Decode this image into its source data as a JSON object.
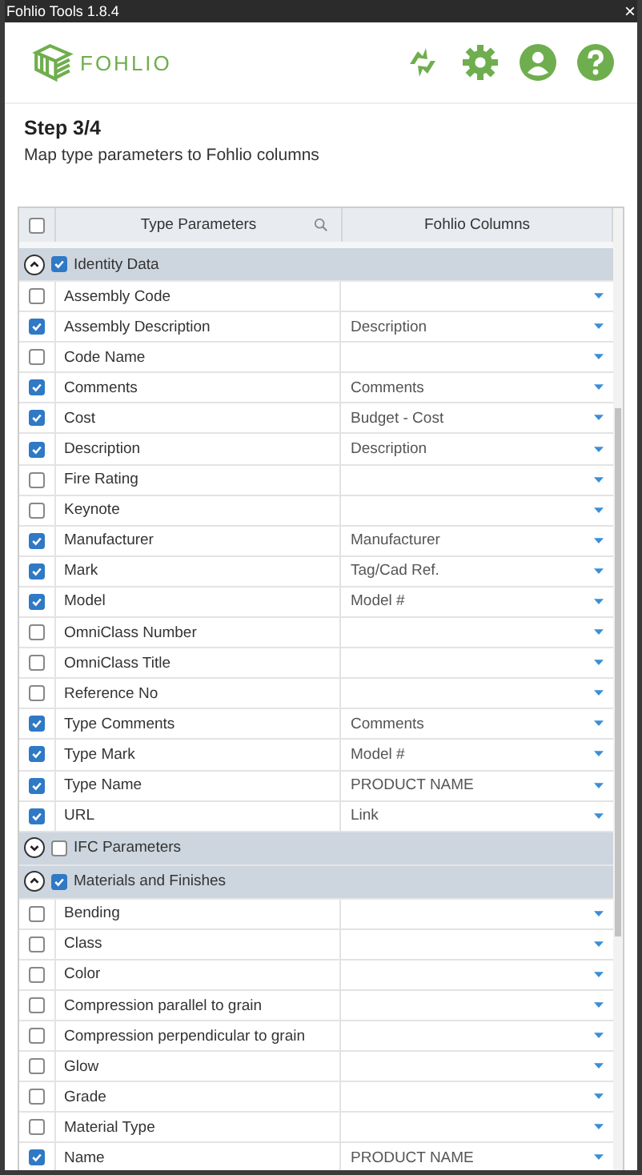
{
  "window": {
    "title": "Fohlio Tools 1.8.4",
    "close": "×"
  },
  "header": {
    "logo_text": "FOHLIO"
  },
  "step": {
    "title": "Step 3/4",
    "subtitle": "Map type parameters to Fohlio columns"
  },
  "table": {
    "select_all_checked": false,
    "columns": [
      "Type Parameters",
      "Fohlio Columns"
    ],
    "groups": [
      {
        "name": "Identity Data",
        "expanded": true,
        "checked": true,
        "rows": [
          {
            "parameter": "Assembly Code",
            "checked": false
          },
          {
            "parameter": "Assembly Description",
            "checked": true,
            "column": "Description"
          },
          {
            "parameter": "Code Name",
            "checked": false
          },
          {
            "parameter": "Comments",
            "checked": true,
            "column": "Comments"
          },
          {
            "parameter": "Cost",
            "checked": true,
            "column": "Budget - Cost"
          },
          {
            "parameter": "Description",
            "checked": true,
            "column": "Description"
          },
          {
            "parameter": "Fire Rating",
            "checked": false
          },
          {
            "parameter": "Keynote",
            "checked": false
          },
          {
            "parameter": "Manufacturer",
            "checked": true,
            "column": "Manufacturer"
          },
          {
            "parameter": "Mark",
            "checked": true,
            "column": "Tag/Cad Ref."
          },
          {
            "parameter": "Model",
            "checked": true,
            "column": "Model #"
          },
          {
            "parameter": "OmniClass Number",
            "checked": false
          },
          {
            "parameter": "OmniClass Title",
            "checked": false
          },
          {
            "parameter": "Reference No",
            "checked": false
          },
          {
            "parameter": "Type Comments",
            "checked": true,
            "column": "Comments"
          },
          {
            "parameter": "Type Mark",
            "checked": true,
            "column": "Model #"
          },
          {
            "parameter": "Type Name",
            "checked": true,
            "column": "PRODUCT NAME"
          },
          {
            "parameter": "URL",
            "checked": true,
            "column": "Link"
          }
        ]
      },
      {
        "name": "IFC Parameters",
        "expanded": false,
        "checked": false
      },
      {
        "name": "Materials and Finishes",
        "expanded": true,
        "checked": true,
        "rows": [
          {
            "parameter": "Bending",
            "checked": false
          },
          {
            "parameter": "Class",
            "checked": false
          },
          {
            "parameter": "Color",
            "checked": false
          },
          {
            "parameter": "Compression parallel to grain",
            "checked": false
          },
          {
            "parameter": "Compression perpendicular to grain",
            "checked": false
          },
          {
            "parameter": "Glow",
            "checked": false
          },
          {
            "parameter": "Grade",
            "checked": false
          },
          {
            "parameter": "Material Type",
            "checked": false
          },
          {
            "parameter": "Name",
            "checked": true,
            "column": "PRODUCT NAME"
          }
        ]
      }
    ]
  }
}
